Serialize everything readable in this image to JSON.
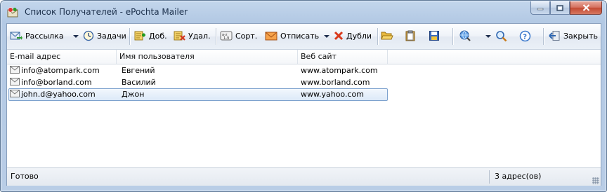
{
  "window": {
    "title": "Список Получателей - ePochta Mailer"
  },
  "toolbar": {
    "mailing_label": "Рассылка",
    "tasks_label": "Задачи",
    "add_label": "Доб.",
    "delete_label": "Удал.",
    "sort_label": "Сорт.",
    "unsubscribe_label": "Отписать",
    "duplicates_label": "Дубли",
    "close_label": "Закрыть"
  },
  "table": {
    "columns": [
      "E-mail адрес",
      "Имя пользователя",
      "Веб сайт"
    ],
    "rows": [
      {
        "email": "info@atompark.com",
        "name": "Евгений",
        "site": "www.atompark.com"
      },
      {
        "email": "info@borland.com",
        "name": "Василий",
        "site": "www.borland.com"
      },
      {
        "email": "john.d@yahoo.com",
        "name": "Джон",
        "site": "www.yahoo.com"
      }
    ],
    "selected_row": 2
  },
  "statusbar": {
    "status": "Готово",
    "count": "3 адрес(ов)"
  },
  "icons": [
    "app-icon",
    "minimize-icon",
    "maximize-icon",
    "close-icon",
    "mailing-icon",
    "clock-icon",
    "add-icon",
    "delete-icon",
    "sort-icon",
    "unsubscribe-envelope-icon",
    "duplicates-x-icon",
    "open-folder-icon",
    "clipboard-icon",
    "save-disk-icon",
    "search-globe-icon",
    "magnifier-icon",
    "help-icon",
    "exit-icon",
    "envelope-icon"
  ]
}
